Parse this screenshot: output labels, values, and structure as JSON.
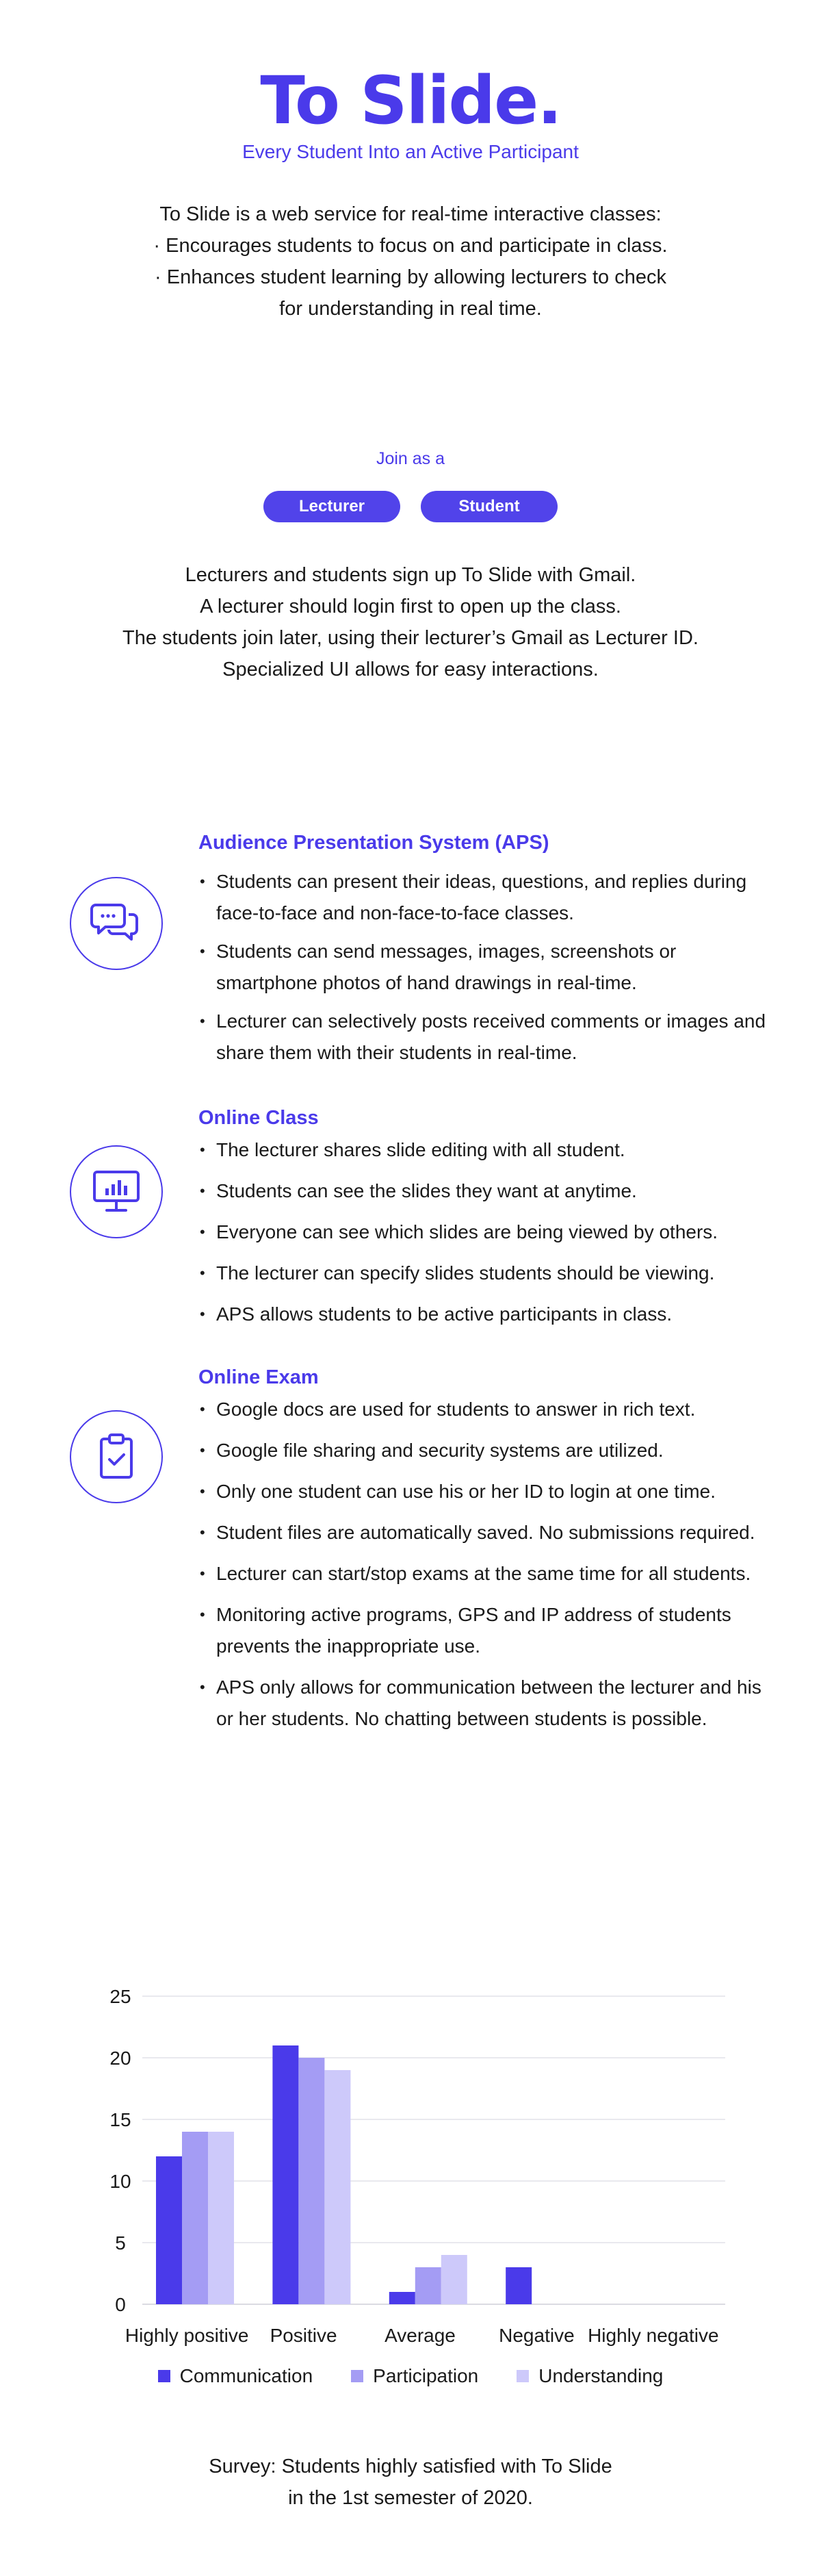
{
  "hero": {
    "logo": "To Slide.",
    "tagline": "Every Student Into an Active Participant",
    "intro": [
      "To Slide is a web service for real-time interactive classes:",
      "· Encourages students to focus on and participate in class.",
      "· Enhances student learning by allowing lecturers to check",
      "for understanding in real time."
    ]
  },
  "join": {
    "label": "Join as a",
    "lecturer_button": "Lecturer",
    "student_button": "Student",
    "description": [
      "Lecturers and students sign up To Slide with Gmail.",
      "A lecturer should login first to open up the class.",
      "The students join later, using their lecturer’s Gmail as Lecturer ID.",
      "Specialized UI allows for easy interactions."
    ]
  },
  "features": [
    {
      "title": "Audience Presentation System (APS)",
      "icon": "chat-bubbles-icon",
      "items": [
        "Students can present their ideas, questions, and replies during face-to-face and non-face-to-face classes.",
        "Students can send messages, images, screenshots or smartphone photos of hand drawings in real-time.",
        "Lecturer can selectively posts received comments or images and share them with their students in real-time."
      ]
    },
    {
      "title": "Online Class",
      "icon": "presentation-board-icon",
      "items": [
        "The lecturer shares slide editing with all student.",
        "Students can see the slides they want at anytime.",
        "Everyone can see which slides are being viewed by others.",
        "The lecturer can specify slides students should be viewing.",
        "APS allows students to be active participants in class."
      ]
    },
    {
      "title": "Online Exam",
      "icon": "clipboard-check-icon",
      "items": [
        "Google docs are used for students to answer in rich text.",
        "Google file sharing and security systems are utilized.",
        "Only one student can use his or her ID to login at one time.",
        "Student files are automatically saved. No submissions required.",
        "Lecturer can start/stop exams at the same time for all students.",
        "Monitoring active programs, GPS and IP address of students prevents the inappropriate use.",
        "APS only allows for communication between the lecturer and his or her students. No chatting between students is possible."
      ]
    }
  ],
  "colors": {
    "accent": "#4a3aea",
    "series": [
      "#4a3aea",
      "#a49cf4",
      "#cdc9fa"
    ],
    "grid": "#e2e2e8"
  },
  "chart_data": {
    "type": "bar",
    "categories": [
      "Highly positive",
      "Positive",
      "Average",
      "Negative",
      "Highly negative"
    ],
    "series": [
      {
        "name": "Communication",
        "values": [
          12,
          21,
          1,
          3,
          0
        ]
      },
      {
        "name": "Participation",
        "values": [
          14,
          20,
          3,
          0,
          0
        ]
      },
      {
        "name": "Understanding",
        "values": [
          14,
          19,
          4,
          0,
          0
        ]
      }
    ],
    "yticks": [
      "0",
      "5",
      "10",
      "15",
      "20",
      "25"
    ],
    "ylim": [
      0,
      25
    ],
    "grid": true,
    "legend": "bottom"
  },
  "caption": [
    "Survey: Students highly satisfied with To Slide",
    "in the 1st semester of 2020."
  ]
}
